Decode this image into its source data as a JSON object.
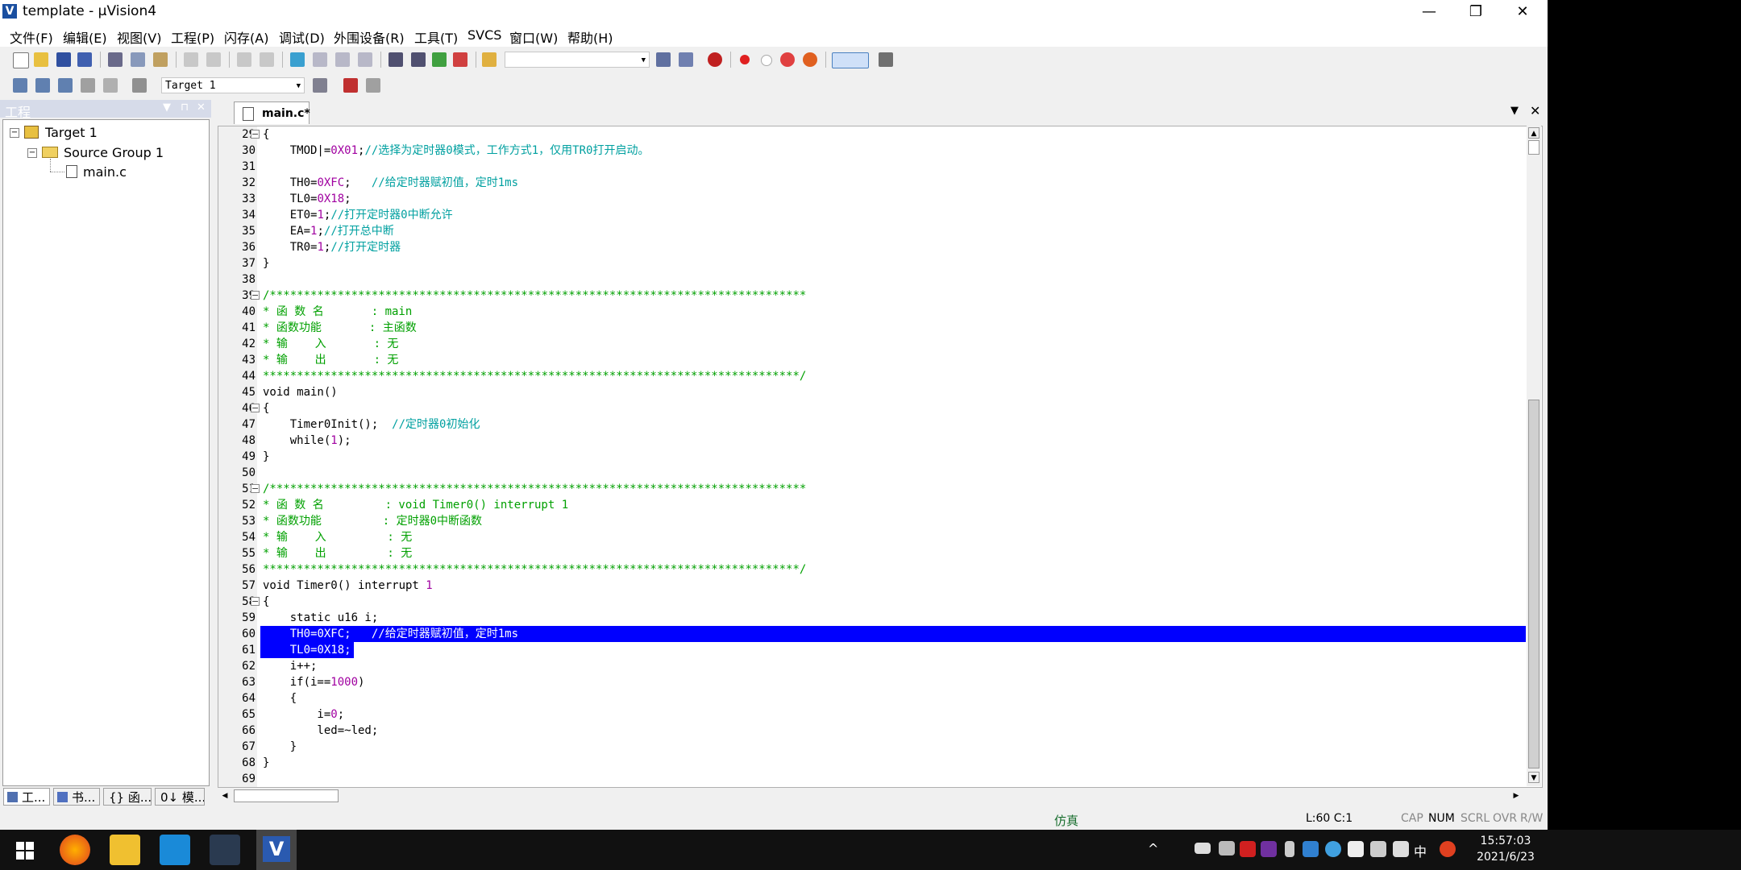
{
  "window": {
    "title": "template  - µVision4",
    "minimize": "—",
    "restore": "❐",
    "close": "✕"
  },
  "menu": [
    {
      "label": "文件(F)"
    },
    {
      "label": "编辑(E)"
    },
    {
      "label": "视图(V)"
    },
    {
      "label": "工程(P)"
    },
    {
      "label": "闪存(A)"
    },
    {
      "label": "调试(D)"
    },
    {
      "label": "外围设备(R)"
    },
    {
      "label": "工具(T)"
    },
    {
      "label": "SVCS"
    },
    {
      "label": "窗口(W)"
    },
    {
      "label": "帮助(H)"
    }
  ],
  "toolbar2": {
    "target_combo": "Target 1"
  },
  "project_pane": {
    "title": "工程",
    "tree": {
      "target": "Target 1",
      "group": "Source Group 1",
      "file": "main.c"
    },
    "tabs": [
      {
        "label": "工...",
        "icon": "project-icon"
      },
      {
        "label": "书...",
        "icon": "books-icon"
      },
      {
        "label": "{} 函...",
        "icon": "functions-icon"
      },
      {
        "label": "0↓ 模...",
        "icon": "templates-icon"
      }
    ]
  },
  "editor": {
    "tab_label": "main.c*",
    "lines": [
      {
        "n": "29",
        "fold": "−",
        "code": "{"
      },
      {
        "n": "30",
        "code": "    TMOD|=0X01;//选择为定时器0模式，工作方式1，仅用TR0打开启动。"
      },
      {
        "n": "31",
        "code": ""
      },
      {
        "n": "32",
        "code": "    TH0=0XFC;   //给定时器赋初值，定时1ms"
      },
      {
        "n": "33",
        "code": "    TL0=0X18;"
      },
      {
        "n": "34",
        "code": "    ET0=1;//打开定时器0中断允许"
      },
      {
        "n": "35",
        "code": "    EA=1;//打开总中断"
      },
      {
        "n": "36",
        "code": "    TR0=1;//打开定时器"
      },
      {
        "n": "37",
        "code": "}"
      },
      {
        "n": "38",
        "code": ""
      },
      {
        "n": "39",
        "fold": "−",
        "code": "/*******************************************************************************"
      },
      {
        "n": "40",
        "code": "* 函 数 名       : main"
      },
      {
        "n": "41",
        "code": "* 函数功能       : 主函数"
      },
      {
        "n": "42",
        "code": "* 输    入       : 无"
      },
      {
        "n": "43",
        "code": "* 输    出       : 无"
      },
      {
        "n": "44",
        "code": "*******************************************************************************/"
      },
      {
        "n": "45",
        "code": "void main()"
      },
      {
        "n": "46",
        "fold": "−",
        "code": "{"
      },
      {
        "n": "47",
        "code": "    Timer0Init();  //定时器0初始化"
      },
      {
        "n": "48",
        "code": "    while(1);"
      },
      {
        "n": "49",
        "code": "}"
      },
      {
        "n": "50",
        "code": ""
      },
      {
        "n": "51",
        "fold": "−",
        "code": "/*******************************************************************************"
      },
      {
        "n": "52",
        "code": "* 函 数 名         : void Timer0() interrupt 1"
      },
      {
        "n": "53",
        "code": "* 函数功能         : 定时器0中断函数"
      },
      {
        "n": "54",
        "code": "* 输    入         : 无"
      },
      {
        "n": "55",
        "code": "* 输    出         : 无"
      },
      {
        "n": "56",
        "code": "*******************************************************************************/"
      },
      {
        "n": "57",
        "code": "void Timer0() interrupt 1"
      },
      {
        "n": "58",
        "fold": "−",
        "code": "{"
      },
      {
        "n": "59",
        "code": "    static u16 i;"
      },
      {
        "n": "60",
        "code": "    TH0=0XFC;   //给定时器赋初值，定时1ms",
        "selected": true
      },
      {
        "n": "61",
        "code": "    TL0=0X18;",
        "selected": true
      },
      {
        "n": "62",
        "code": "    i++;"
      },
      {
        "n": "63",
        "code": "    if(i==1000)"
      },
      {
        "n": "64",
        "code": "    {"
      },
      {
        "n": "65",
        "code": "        i=0;"
      },
      {
        "n": "66",
        "code": "        led=~led;"
      },
      {
        "n": "67",
        "code": "    }"
      },
      {
        "n": "68",
        "code": "}"
      },
      {
        "n": "69",
        "code": ""
      }
    ]
  },
  "status": {
    "mode": "仿真",
    "position": "L:60 C:1",
    "cap": "CAP",
    "num": "NUM",
    "scrl": "SCRL",
    "ovr": "OVR",
    "rw": "R/W"
  },
  "taskbar": {
    "time": "15:57:03",
    "date": "2021/6/23",
    "ime": "中",
    "tray_chevron": "^"
  }
}
